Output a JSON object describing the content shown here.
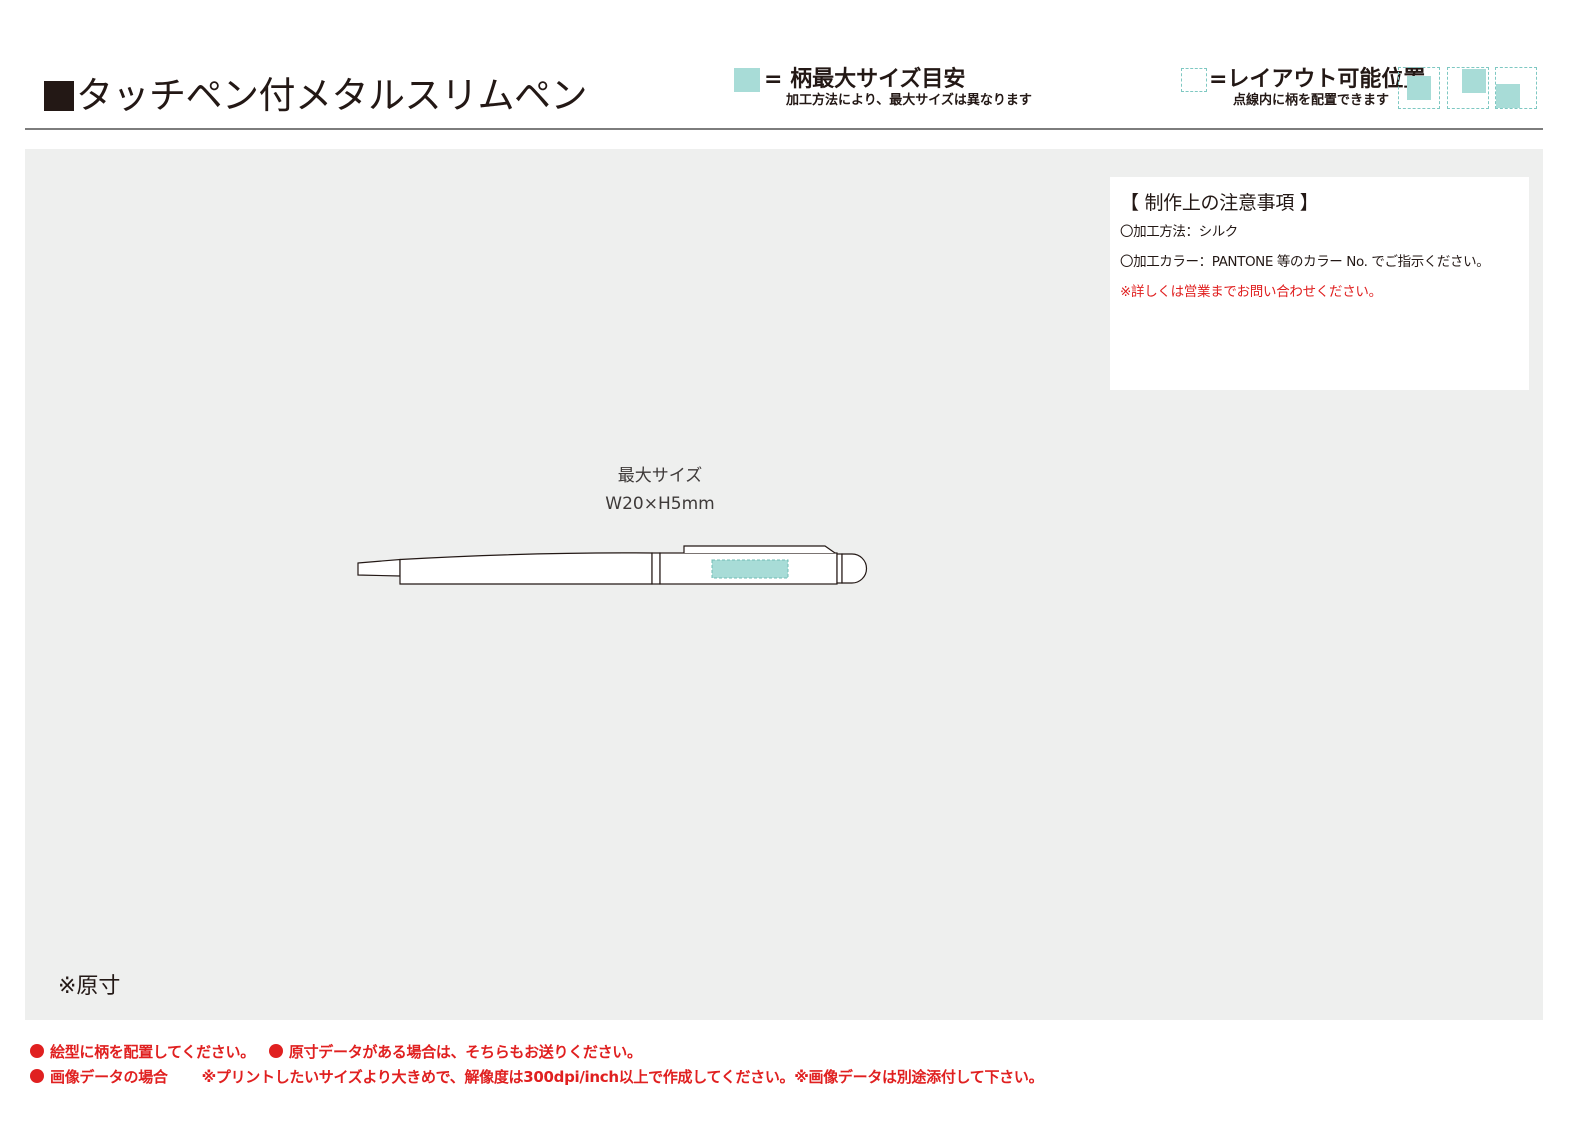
{
  "header": {
    "title": "タッチペン付メタルスリムペン"
  },
  "legend": {
    "max_size_label": "= 柄最大サイズ目安",
    "max_size_note": "加工方法により、最大サイズは異なります",
    "layout_label": "=レイアウト可能位置",
    "layout_note": "点線内に柄を配置できます",
    "swatch_color": "#a8dcd7",
    "dash_color": "#7ec8c2"
  },
  "notes": {
    "heading": "【 制作上の注意事項 】",
    "method": "〇加工方法：シルク",
    "color": "〇加工カラー：PANTONE 等のカラー No. でご指示ください。",
    "warning": "※詳しくは営業までお問い合わせください。"
  },
  "product": {
    "max_size_title": "最大サイズ",
    "max_size_value": "W20×H5mm"
  },
  "panel": {
    "actual_size_note": "※原寸"
  },
  "footer": {
    "line1_a": "絵型に柄を配置してください。",
    "line1_b": "原寸データがある場合は、そちらもお送りください。",
    "line2_a": "画像データの場合",
    "line2_b": "※プリントしたいサイズより大きめで、解像度は300dpi/inch以上で作成してください。※画像データは別途添付して下さい。"
  }
}
